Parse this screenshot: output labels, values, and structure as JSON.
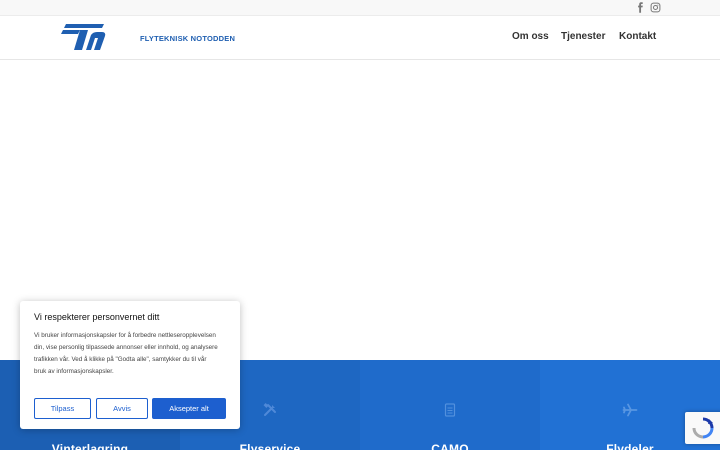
{
  "topbar": {
    "social": [
      {
        "icon": "facebook-icon"
      },
      {
        "icon": "instagram-icon"
      }
    ]
  },
  "header": {
    "logo_text": "FLYTEKNISK NOTODDEN",
    "nav": [
      "Om oss",
      "Tjenester",
      "Kontakt"
    ]
  },
  "services": [
    {
      "title": "Vinterlagring",
      "icon": "",
      "color": "#1c5fb3"
    },
    {
      "title": "Flyservice",
      "icon": "tools-icon",
      "color": "#1e67c2"
    },
    {
      "title": "CAMO",
      "icon": "document-icon",
      "color": "#1f6bcb"
    },
    {
      "title": "Flydeler",
      "icon": "airplane-icon",
      "color": "#2171d4"
    }
  ],
  "cookie": {
    "title": "Vi respekterer personvernet ditt",
    "body": "Vi bruker informasjonskapsler for å forbedre nettleseropplevelsen din, vise personlig tilpassede annonser eller innhold, og analysere trafikken vår. Ved å klikke på \"Godta alle\", samtykker du til vår bruk av informasjonskapsler.",
    "buttons": {
      "customize": "Tilpass",
      "reject": "Avvis",
      "accept": "Aksepter alt"
    }
  },
  "colors": {
    "brand": "#1f5fb1",
    "button": "#1d5fcf"
  }
}
